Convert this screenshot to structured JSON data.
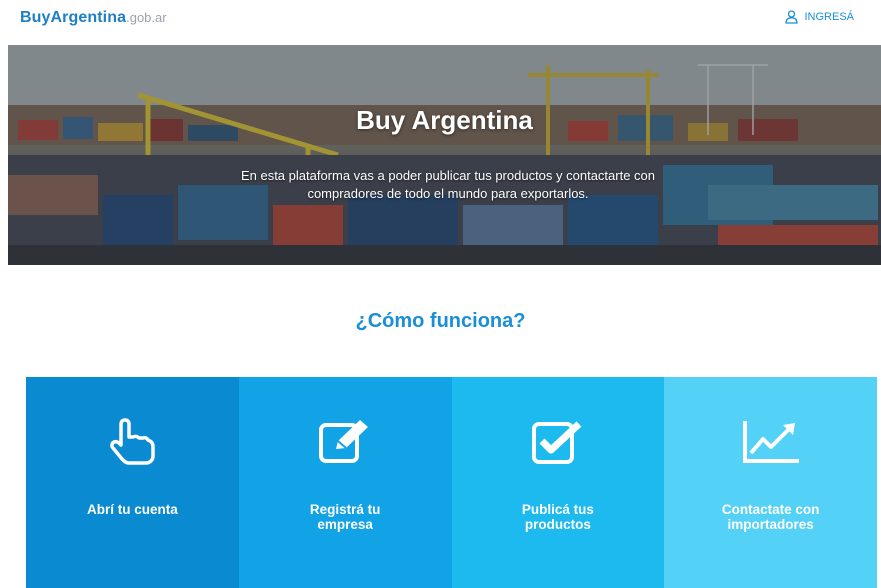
{
  "header": {
    "logo_brand": "BuyArgentina",
    "logo_suffix": ".gob.ar",
    "login_label": "INGRESÁ",
    "login_icon": "user-icon"
  },
  "hero": {
    "title": "Buy Argentina",
    "subtitle": "En esta plataforma vas a poder publicar tus productos y contactarte con compradores de todo el mundo para exportarlos."
  },
  "how_it_works": {
    "title": "¿Cómo funciona?",
    "steps": [
      {
        "label": "Abrí tu cuenta",
        "icon": "pointer-hand-icon",
        "color": "#0a8ad0"
      },
      {
        "label": "Registrá tu\nempresa",
        "icon": "edit-icon",
        "color": "#12a3e6"
      },
      {
        "label": "Publicá tus\nproductos",
        "icon": "checkbox-icon",
        "color": "#1cbaef"
      },
      {
        "label": "Contactate con\nimportadores",
        "icon": "chart-line-icon",
        "color": "#53d1f7"
      }
    ]
  }
}
